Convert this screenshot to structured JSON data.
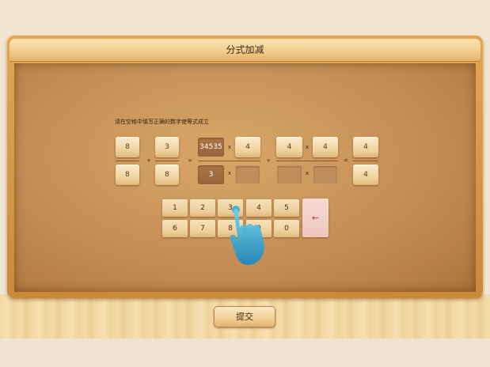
{
  "header": {
    "title": "分式加减"
  },
  "instruction": "请在空格中填写正确的数字使等式成立",
  "equation": {
    "frac1": {
      "num": "8",
      "den": "8"
    },
    "plus1": "+",
    "frac2": {
      "num": "3",
      "den": "8"
    },
    "equals1": "=",
    "frac3": {
      "num": "34535",
      "num_mult": "4",
      "den": "3",
      "den_mult": ""
    },
    "times": "x",
    "plus2": "+",
    "frac4": {
      "num": "4",
      "num_mult": "4",
      "den": "",
      "den_mult": ""
    },
    "equals2": "=",
    "frac5": {
      "num": "4",
      "den": "4"
    }
  },
  "keypad": {
    "keys": [
      "1",
      "2",
      "3",
      "4",
      "5",
      "6",
      "7",
      "8",
      "9",
      "0"
    ],
    "backspace": "←"
  },
  "submit_label": "提交",
  "colors": {
    "board": "#c8935a",
    "given_box": "#a06c40",
    "backspace": "#c03040"
  }
}
